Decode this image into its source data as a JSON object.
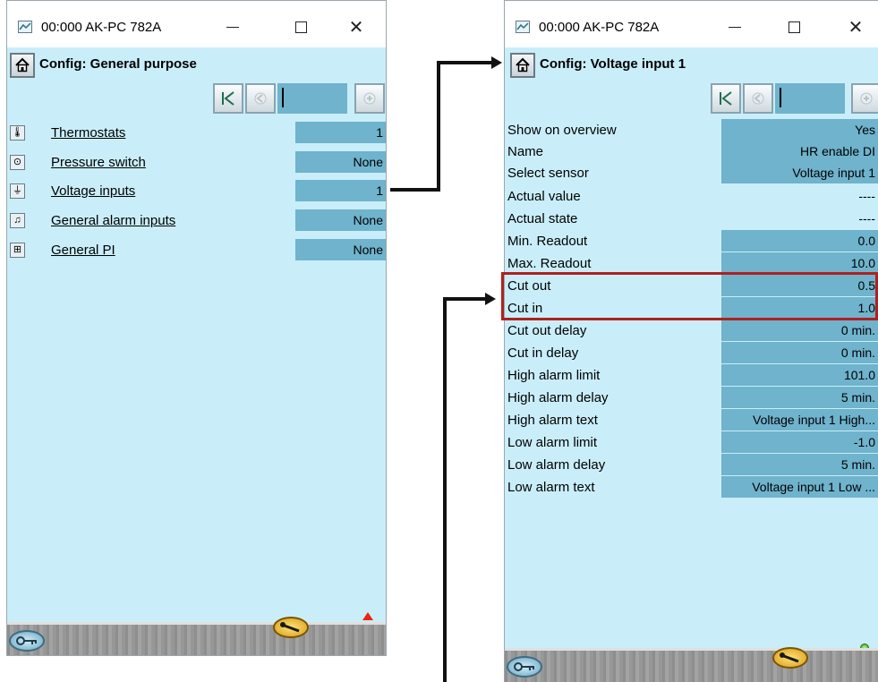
{
  "window_left": {
    "title": "00:000 AK-PC 782A",
    "config_title": "Config: General purpose",
    "rows": [
      {
        "icon": "thermostat-icon",
        "label": "Thermostats",
        "value": "1"
      },
      {
        "icon": "pressure-switch-icon",
        "label": "Pressure switch",
        "value": "None"
      },
      {
        "icon": "voltage-input-icon",
        "label": "Voltage inputs",
        "value": "1"
      },
      {
        "icon": "alarm-input-icon",
        "label": "General alarm inputs",
        "value": "None"
      },
      {
        "icon": "pi-controller-icon",
        "label": "General PI",
        "value": "None"
      }
    ]
  },
  "window_right": {
    "title": "00:000 AK-PC 782A",
    "config_title": "Config: Voltage input 1",
    "rows": [
      {
        "label": "Show on overview",
        "value": "Yes",
        "editable": true
      },
      {
        "label": "Name",
        "value": "HR enable DI",
        "editable": true
      },
      {
        "label": "Select sensor",
        "value": "Voltage input 1",
        "editable": true
      },
      {
        "label": "Actual value",
        "value": "----",
        "editable": false
      },
      {
        "label": "Actual state",
        "value": "----",
        "editable": false
      },
      {
        "label": "Min. Readout",
        "value": "0.0",
        "editable": true
      },
      {
        "label": "Max. Readout",
        "value": "10.0",
        "editable": true
      },
      {
        "label": "Cut out",
        "value": "0.5",
        "editable": true
      },
      {
        "label": "Cut in",
        "value": "1.0",
        "editable": true
      },
      {
        "label": "Cut out delay",
        "value": "0 min.",
        "editable": true
      },
      {
        "label": "Cut in delay",
        "value": "0 min.",
        "editable": true
      },
      {
        "label": "High alarm limit",
        "value": "101.0",
        "editable": true
      },
      {
        "label": "High alarm delay",
        "value": "5 min.",
        "editable": true
      },
      {
        "label": "High alarm text",
        "value": "Voltage input 1 High...",
        "editable": true
      },
      {
        "label": "Low alarm limit",
        "value": "-1.0",
        "editable": true
      },
      {
        "label": "Low alarm delay",
        "value": "5 min.",
        "editable": true
      },
      {
        "label": "Low alarm text",
        "value": "Voltage input 1 Low ...",
        "editable": true
      }
    ]
  },
  "colors": {
    "panel_bg": "#c9eef9",
    "value_bg": "#6fb3cd",
    "highlight": "#b0201f",
    "alarm": "#ee2211",
    "status_ok": "#2f9a1a"
  }
}
